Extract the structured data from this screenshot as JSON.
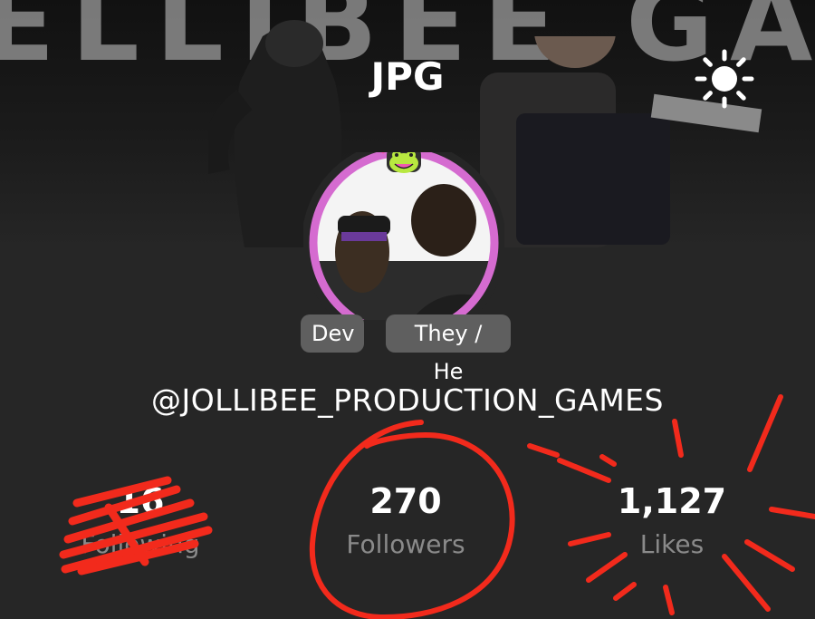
{
  "banner": {
    "background_text": "ELLIBEE GAME"
  },
  "header": {
    "title": "JPG",
    "theme_icon": "sun-icon"
  },
  "profile": {
    "avatar_icon": "frog-badge-icon",
    "badges": [
      "Dev",
      "They / He"
    ],
    "username": "@JOLLIBEE_PRODUCTION_GAMES"
  },
  "stats": {
    "following": {
      "value": "16",
      "label": "Following"
    },
    "followers": {
      "value": "270",
      "label": "Followers"
    },
    "likes": {
      "value": "1,127",
      "label": "Likes"
    }
  },
  "colors": {
    "page_background": "#262626",
    "badge_background": "#5f5f5f",
    "stat_label": "#8a8a8a",
    "avatar_ring": "#d56bd0",
    "annotation_red": "#f22a1c"
  }
}
